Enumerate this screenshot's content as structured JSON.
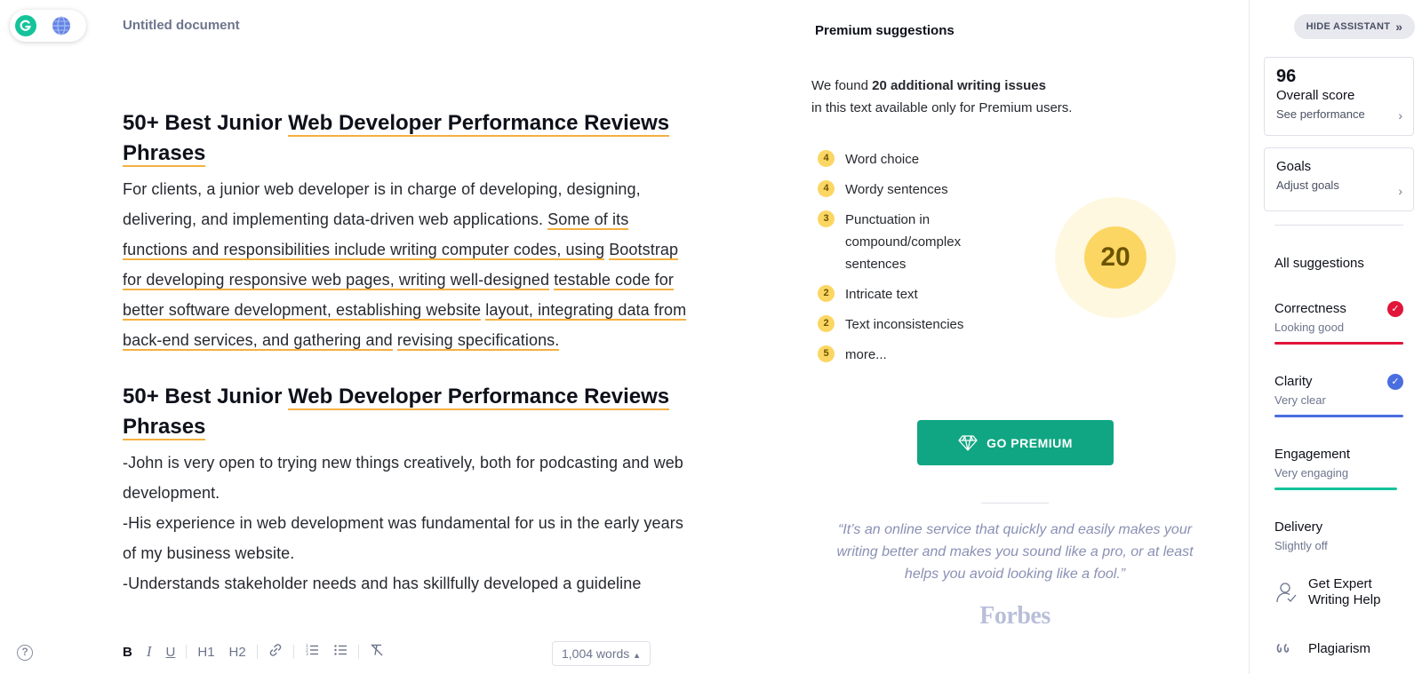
{
  "document": {
    "title": "Untitled document",
    "heading1": {
      "plain": "50+ Best Junior ",
      "underlined_a": "Web Developer Performance Reviews",
      "underlined_b": "Phrases"
    },
    "paragraph1": {
      "plain": "For clients, a junior web developer is in charge of developing, designing, delivering, and implementing data-driven web applications. ",
      "underlined": [
        "Some of its",
        "functions and responsibilities include writing computer codes, using",
        "Bootstrap for developing responsive web pages, writing well-designed",
        "testable code for better software development, establishing website",
        "layout, integrating data from back-end services, and gathering and",
        "revising specifications."
      ]
    },
    "heading2": {
      "plain": "50+ Best Junior ",
      "underlined_a": "Web Developer Performance Reviews",
      "underlined_b": "Phrases"
    },
    "lines": [
      "-John is very open to trying new things creatively, both for podcasting and web development.",
      " -His experience in web development was fundamental for us in the early years of my business website.",
      " -Understands stakeholder needs and has skillfully developed a guideline"
    ]
  },
  "toolbar": {
    "help": "?",
    "bold": "B",
    "italic": "I",
    "underline": "U",
    "h1": "H1",
    "h2": "H2",
    "word_count": "1,004 words"
  },
  "premium": {
    "title": "Premium suggestions",
    "intro_prefix": "We found ",
    "intro_bold": "20 additional writing issues",
    "intro_suffix": "in this text available only for Premium users.",
    "issues": [
      {
        "count": "4",
        "label": "Word choice"
      },
      {
        "count": "4",
        "label": "Wordy sentences"
      },
      {
        "count": "3",
        "label": "Punctuation in compound/complex sentences"
      },
      {
        "count": "2",
        "label": "Intricate text"
      },
      {
        "count": "2",
        "label": "Text inconsistencies"
      },
      {
        "count": "5",
        "label": "more..."
      }
    ],
    "total": "20",
    "button_label": "GO PREMIUM",
    "quote": "“It’s an online service that quickly and easily makes your writing better and makes you sound like a pro, or at least helps you avoid looking like a fool.”",
    "quote_source": "Forbes",
    "accent_color": "#11a683",
    "badge_color": "#fcd663"
  },
  "sidebar": {
    "hide_label": "HIDE ASSISTANT",
    "score": {
      "value": "96",
      "label": "Overall score",
      "link": "See performance"
    },
    "goals": {
      "label": "Goals",
      "link": "Adjust goals"
    },
    "all_suggestions": "All suggestions",
    "metrics": [
      {
        "name": "Correctness",
        "status": "Looking good",
        "color": "#e2153a",
        "checked": true,
        "level": 1.0
      },
      {
        "name": "Clarity",
        "status": "Very clear",
        "color": "#4a6ee0",
        "checked": true,
        "level": 1.0
      },
      {
        "name": "Engagement",
        "status": "Very engaging",
        "color": "#15c39a",
        "checked": false,
        "level": 0.95
      },
      {
        "name": "Delivery",
        "status": "Slightly off",
        "color": "#fcd663",
        "checked": false,
        "level": 0.0
      }
    ],
    "expert_help": "Get Expert Writing Help",
    "plagiarism": "Plagiarism"
  }
}
